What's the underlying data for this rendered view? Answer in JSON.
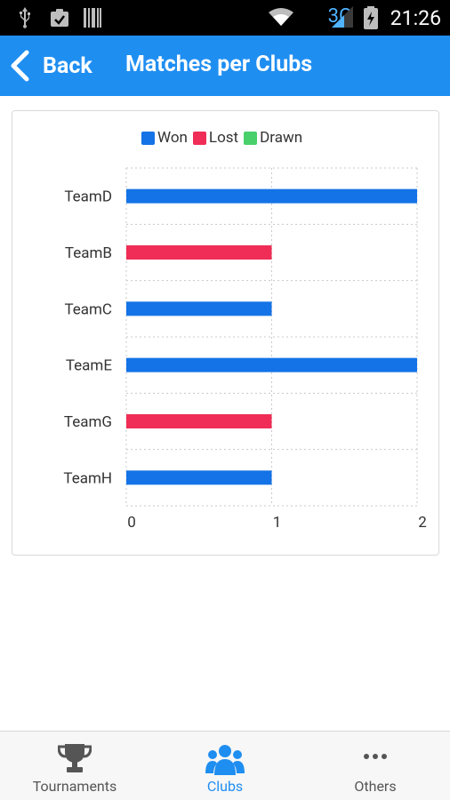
{
  "status_bar": {
    "time": "21:26",
    "network": "3G"
  },
  "header": {
    "back_label": "Back",
    "title": "Matches per Clubs"
  },
  "chart_data": {
    "type": "bar",
    "orientation": "horizontal",
    "categories": [
      "TeamD",
      "TeamB",
      "TeamC",
      "TeamE",
      "TeamG",
      "TeamH"
    ],
    "series": [
      {
        "name": "Won",
        "color": "#1473e6",
        "values": [
          2,
          0,
          1,
          2,
          0,
          1
        ]
      },
      {
        "name": "Lost",
        "color": "#ef2d56",
        "values": [
          0,
          1,
          0,
          0,
          1,
          0
        ]
      },
      {
        "name": "Drawn",
        "color": "#49d06a",
        "values": [
          0,
          0,
          0,
          0,
          0,
          0
        ]
      }
    ],
    "xlim": [
      0,
      2
    ],
    "x_ticks": [
      "0",
      "1",
      "2"
    ],
    "grid": true,
    "legend_position": "top"
  },
  "bottom_nav": {
    "items": [
      {
        "label": "Tournaments",
        "icon": "trophy-icon"
      },
      {
        "label": "Clubs",
        "icon": "group-icon",
        "active": true
      },
      {
        "label": "Others",
        "icon": "more-icon"
      }
    ],
    "active_color": "#1f8ef1"
  }
}
